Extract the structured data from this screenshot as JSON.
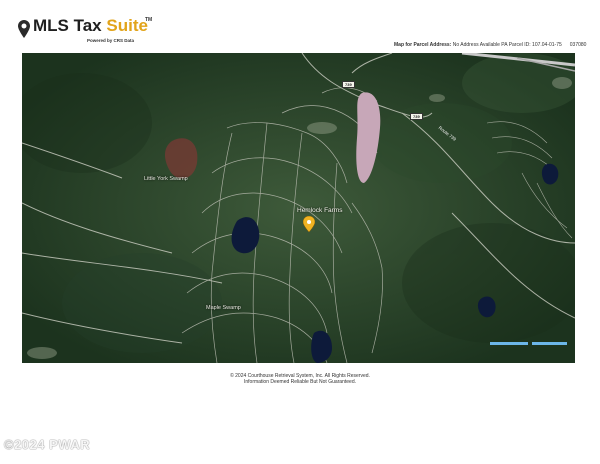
{
  "header": {
    "logo_main": "MLS Tax ",
    "logo_accent": "Suite",
    "logo_tm": "TM",
    "powered_by": "Powered by CRS Data",
    "parcel_prefix": "Map for Parcel Address:",
    "parcel_detail": " No Address Available PA Parcel ID: 107.04-01-75",
    "parcel_code": "037080"
  },
  "map": {
    "labels": {
      "little_york_swamp": "Little York Swamp",
      "hemlock_farms": "Hemlock Farms",
      "maple_swamp": "Maple Swamp",
      "route_739_a": "739",
      "route_739_b": "739",
      "road_name": "Route 739"
    },
    "colors": {
      "forest": "#1f3a22",
      "water": "#0d1a3a",
      "marker": "#f0b323",
      "scale": "#6cb6e8"
    }
  },
  "footer": {
    "copyright_line1": "© 2024 Courthouse Retrieval System, Inc. All Rights Reserved.",
    "copyright_line2": "Information Deemed Reliable But Not Guaranteed."
  },
  "watermark": {
    "text": "©2024 PWAR"
  }
}
